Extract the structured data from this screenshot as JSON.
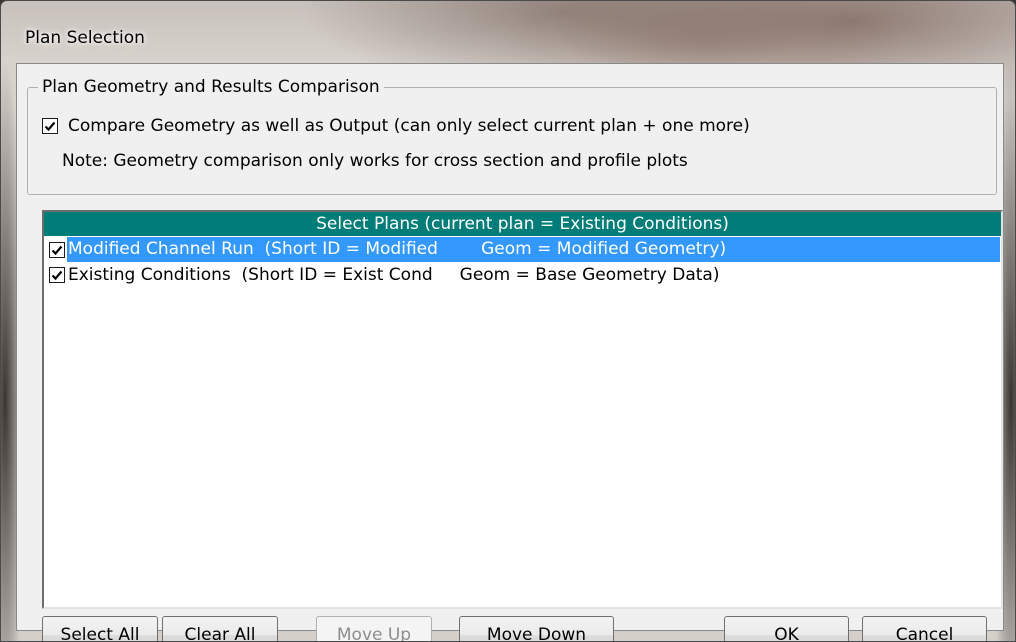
{
  "window": {
    "title": "Plan Selection"
  },
  "group": {
    "legend": "Plan Geometry and Results Comparison",
    "compare_checked": true,
    "compare_label": "Compare Geometry as well as Output (can only select current plan + one more)",
    "note": "Note: Geometry comparison only works for cross section and profile plots"
  },
  "plans_list": {
    "header": "Select Plans  (current plan = Existing Conditions)",
    "items": [
      {
        "checked": true,
        "selected": true,
        "text": "Modified Channel Run  (Short ID = Modified        Geom = Modified Geometry)"
      },
      {
        "checked": true,
        "selected": false,
        "text": "Existing Conditions  (Short ID = Exist Cond     Geom = Base Geometry Data)"
      }
    ]
  },
  "buttons": {
    "select_all": "Select All",
    "clear_all": "Clear All",
    "move_up": "Move Up",
    "move_down": "Move Down",
    "ok": "OK",
    "cancel": "Cancel"
  },
  "colors": {
    "list_header_bg": "#007d78",
    "selection_bg": "#3399ff"
  }
}
